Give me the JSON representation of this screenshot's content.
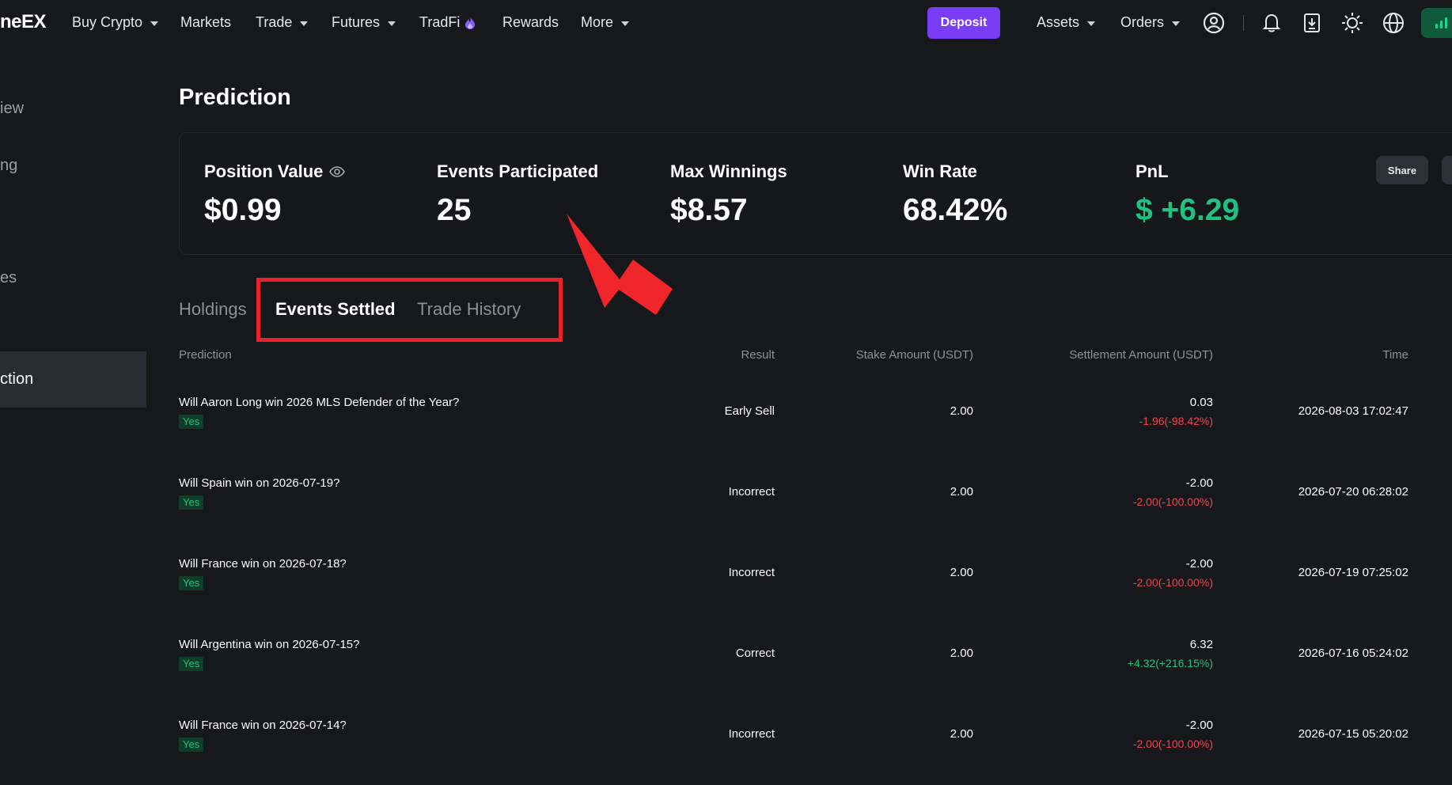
{
  "nav": {
    "logo": "neEX",
    "items": [
      "Buy Crypto",
      "Markets",
      "Trade",
      "Futures",
      "TradFi",
      "Rewards",
      "More"
    ],
    "deposit_label": "Deposit",
    "assets_label": "Assets",
    "orders_label": "Orders"
  },
  "sidebar": {
    "items": [
      "iew",
      "ng",
      "es"
    ],
    "active": "ction"
  },
  "page_title": "Prediction",
  "stats": {
    "position_value_label": "Position Value",
    "position_value": "$0.99",
    "events_label": "Events Participated",
    "events_value": "25",
    "max_winnings_label": "Max Winnings",
    "max_winnings_value": "$8.57",
    "win_rate_label": "Win Rate",
    "win_rate_value": "68.42%",
    "pnl_label": "PnL",
    "pnl_value": "$ +6.29",
    "share_label": "Share"
  },
  "tabs": [
    "Holdings",
    "Events Settled",
    "Trade History"
  ],
  "table": {
    "headers": {
      "prediction": "Prediction",
      "result": "Result",
      "stake": "Stake Amount (USDT)",
      "settlement": "Settlement Amount (USDT)",
      "time": "Time"
    },
    "rows": [
      {
        "question": "Will Aaron Long win 2026 MLS Defender of the Year?",
        "side": "Yes",
        "result": "Early Sell",
        "stake": "2.00",
        "settlement": "0.03",
        "pnl": "-1.96(-98.42%)",
        "time": "2026-08-03 17:02:47"
      },
      {
        "question": "Will Spain win on 2026-07-19?",
        "side": "Yes",
        "result": "Incorrect",
        "stake": "2.00",
        "settlement": "-2.00",
        "pnl": "-2.00(-100.00%)",
        "time": "2026-07-20 06:28:02"
      },
      {
        "question": "Will France win on 2026-07-18?",
        "side": "Yes",
        "result": "Incorrect",
        "stake": "2.00",
        "settlement": "-2.00",
        "pnl": "-2.00(-100.00%)",
        "time": "2026-07-19 07:25:02"
      },
      {
        "question": "Will Argentina win on 2026-07-15?",
        "side": "Yes",
        "result": "Correct",
        "stake": "2.00",
        "settlement": "6.32",
        "pnl": "+4.32(+216.15%)",
        "time": "2026-07-16 05:24:02"
      },
      {
        "question": "Will France win on 2026-07-14?",
        "side": "Yes",
        "result": "Incorrect",
        "stake": "2.00",
        "settlement": "-2.00",
        "pnl": "-2.00(-100.00%)",
        "time": "2026-07-15 05:20:02"
      }
    ]
  },
  "colors": {
    "accent": "#7a3cf5",
    "positive": "#1ec27f",
    "negative": "#f0434d",
    "annotation": "#e8232a"
  }
}
